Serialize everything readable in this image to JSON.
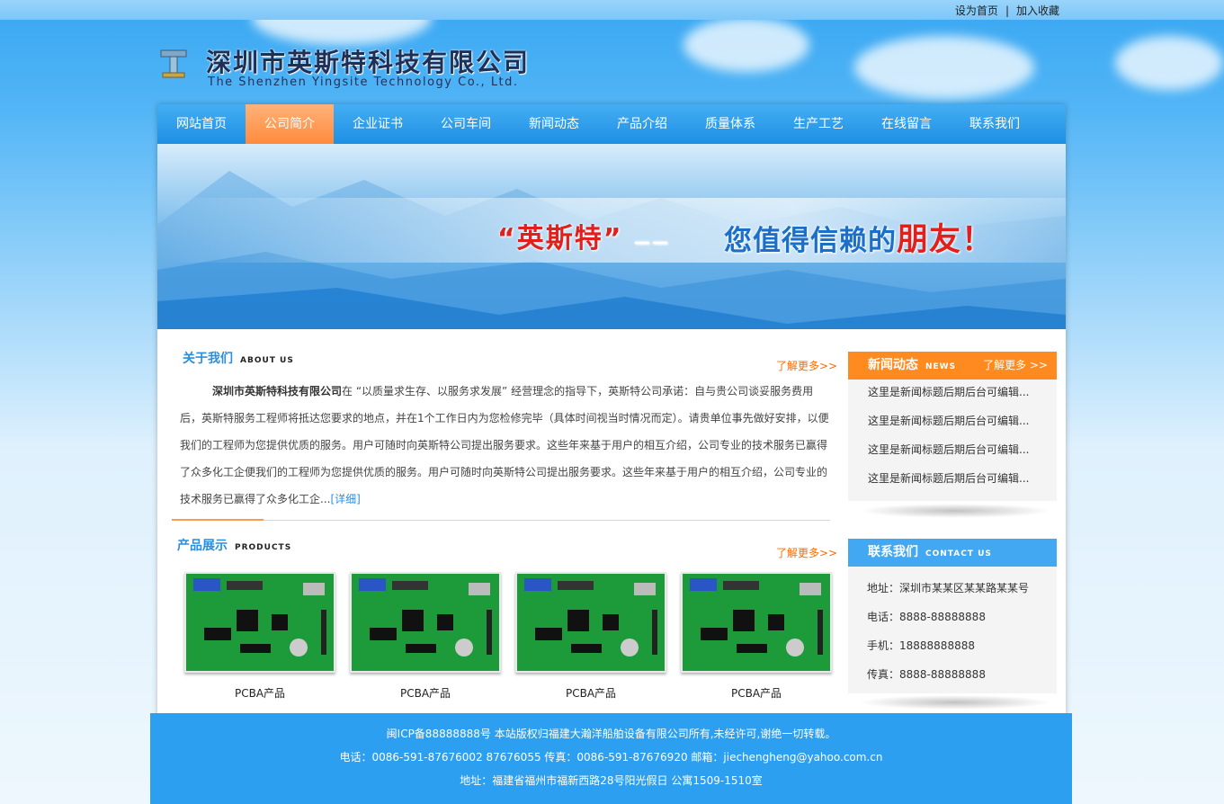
{
  "top_links": {
    "set_home": "设为首页",
    "separator": "|",
    "favorite": "加入收藏"
  },
  "logo": {
    "cn": "深圳市英斯特科技有限公司",
    "en": "The Shenzhen Yingsite Technology Co., Ltd."
  },
  "nav": {
    "items": [
      {
        "label": "网站首页",
        "active": false
      },
      {
        "label": "公司简介",
        "active": true
      },
      {
        "label": "企业证书",
        "active": false
      },
      {
        "label": "公司车间",
        "active": false
      },
      {
        "label": "新闻动态",
        "active": false
      },
      {
        "label": "产品介绍",
        "active": false
      },
      {
        "label": "质量体系",
        "active": false
      },
      {
        "label": "生产工艺",
        "active": false
      },
      {
        "label": "在线留言",
        "active": false
      },
      {
        "label": "联系我们",
        "active": false
      }
    ]
  },
  "banner": {
    "slogan_red": "“英斯特”",
    "dash": "——",
    "slogan_blue": "您值得信赖的",
    "slogan_red2": "朋友！"
  },
  "about": {
    "title_cn": "关于我们",
    "title_en": "ABOUT US",
    "more": "了解更多>>",
    "company": "深圳市英斯特科技有限公司",
    "text": "在 “以质量求生存、以服务求发展” 经营理念的指导下，英斯特公司承诺：自与贵公司谈妥服务费用后，英斯特服务工程师将抵达您要求的地点，并在1个工作日内为您检修完毕（具体时间视当时情况而定）。请贵单位事先做好安排，以便我们的工程师为您提供优质的服务。用户可随时向英斯特公司提出服务要求。这些年来基于用户的相互介绍，公司专业的技术服务已赢得了众多化工企便我们的工程师为您提供优质的服务。用户可随时向英斯特公司提出服务要求。这些年来基于用户的相互介绍，公司专业的技术服务已赢得了众多化工企...",
    "detail": "[详细]"
  },
  "products": {
    "title_cn": "产品展示",
    "title_en": "PRODUCTS",
    "more": "了解更多>>",
    "items": [
      {
        "label": "PCBA产品"
      },
      {
        "label": "PCBA产品"
      },
      {
        "label": "PCBA产品"
      },
      {
        "label": "PCBA产品"
      }
    ]
  },
  "news": {
    "title_cn": "新闻动态",
    "title_en": "NEWS",
    "more": "了解更多 >>",
    "items": [
      "这里是新闻标题后期后台可编辑...",
      "这里是新闻标题后期后台可编辑...",
      "这里是新闻标题后期后台可编辑...",
      "这里是新闻标题后期后台可编辑..."
    ]
  },
  "contact": {
    "title_cn": "联系我们",
    "title_en": "CONTACT US",
    "items": [
      "地址：深圳市某某区某某路某某号",
      "电话：8888-88888888",
      "手机：18888888888",
      "传真：8888-88888888"
    ]
  },
  "footer": {
    "line1": "闽ICP备88888888号    本站版权归福建大瀚洋船舶设备有限公司所有,未经许可,谢绝一切转载。",
    "line2": "电话：0086-591-87676002 87676055    传真：0086-591-87676920    邮箱：jiechengheng@yahoo.com.cn",
    "line3": "地址：福建省福州市福新西路28号阳光假日 公寓1509-1510室"
  },
  "colors": {
    "nav_blue": "#1d8fe4",
    "nav_active": "#ff8a3c",
    "accent_blue": "#2a8fe0",
    "more_orange": "#ff6a00",
    "footer_blue": "#2c9ff0"
  }
}
